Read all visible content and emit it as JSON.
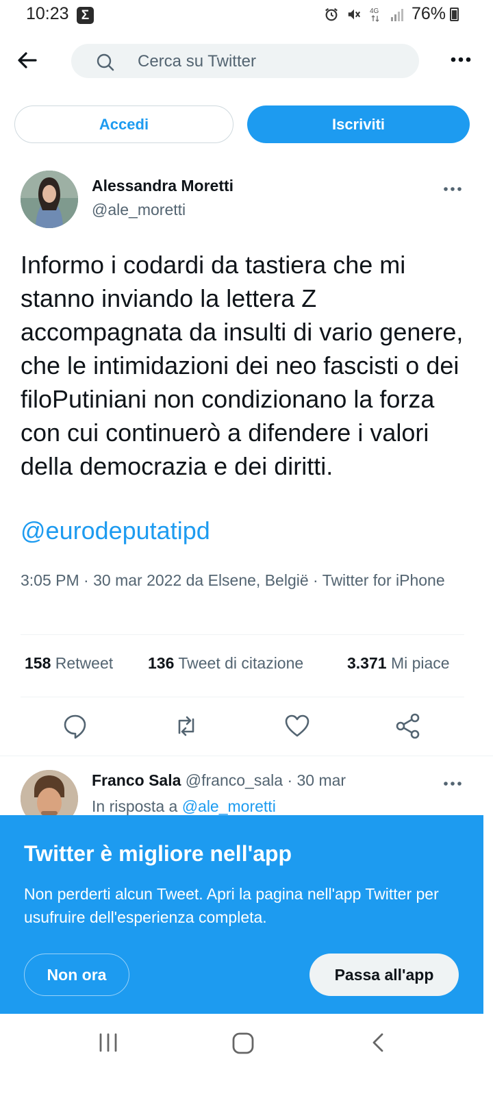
{
  "status_bar": {
    "time": "10:23",
    "sigma_glyph": "Σ",
    "network": "4G",
    "battery": "76%"
  },
  "nav": {
    "search_placeholder": "Cerca su Twitter"
  },
  "auth": {
    "login_label": "Accedi",
    "signup_label": "Iscriviti"
  },
  "tweet": {
    "author_name": "Alessandra Moretti",
    "author_handle": "@ale_moretti",
    "text": "Informo i codardi da tastiera che mi stanno inviando la lettera Z accompagnata da insulti di vario genere, che le intimidazioni dei neo fascisti o dei filoPutiniani non condizionano la forza con cui continuerò a difendere i valori della democrazia e dei diritti.",
    "mention": "@eurodeputatipd",
    "meta": "3:05 PM · 30 mar 2022 da Elsene, België · Twitter for iPhone",
    "stats": {
      "retweets_count": "158",
      "retweets_label": "Retweet",
      "quotes_count": "136",
      "quotes_label": "Tweet di citazione",
      "likes_count": "3.371",
      "likes_label": "Mi piace"
    }
  },
  "reply": {
    "name": "Franco Sala",
    "handle": "@franco_sala",
    "date": "· 30 mar",
    "reply_prefix": "In risposta a",
    "reply_to": "@ale_moretti"
  },
  "banner": {
    "title": "Twitter è migliore nell'app",
    "text": "Non perderti alcun Tweet. Apri la pagina nell'app Twitter per usufruire dell'esperienza completa.",
    "not_now_label": "Non ora",
    "open_app_label": "Passa all'app"
  },
  "colors": {
    "accent": "#1d9bf0",
    "text_primary": "#0f1419",
    "text_secondary": "#536471"
  }
}
